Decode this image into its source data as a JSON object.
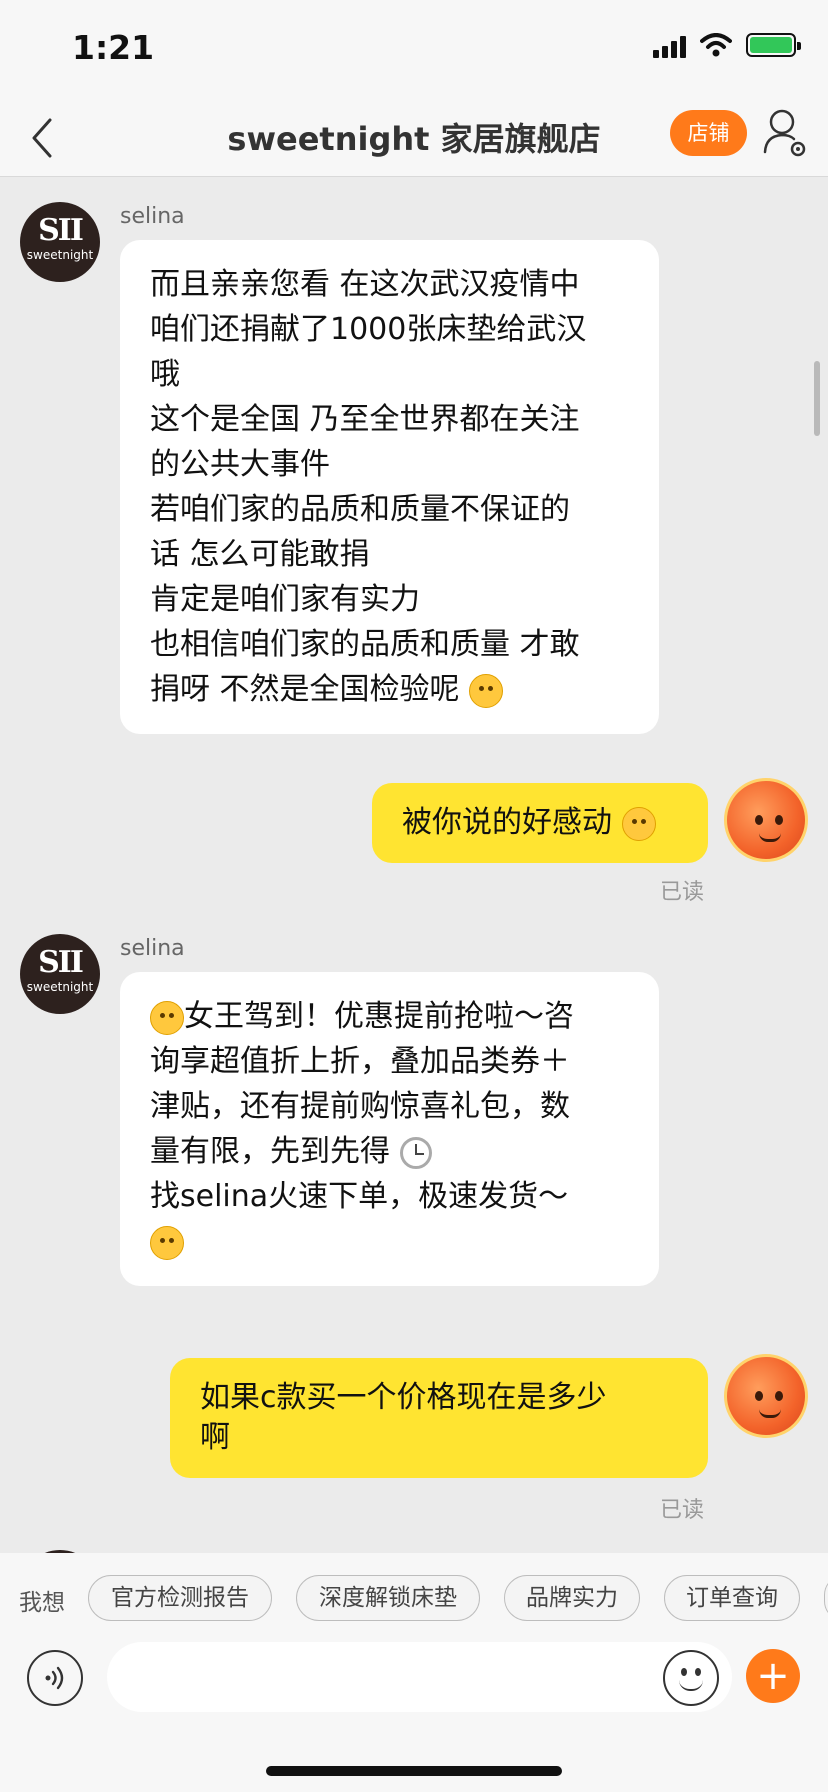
{
  "status_bar": {
    "time": "1:21"
  },
  "header": {
    "title": "sweetnight 家居旗舰店",
    "shop_button_label": "店铺"
  },
  "shop_avatar": {
    "mark": "SII",
    "text": "sweetnight"
  },
  "messages": [
    {
      "sender": "selina",
      "lines": [
        "而且亲亲您看 在这次武汉疫情中",
        "咱们还捐献了1000张床垫给武汉",
        "哦",
        "这个是全国 乃至全世界都在关注",
        "的公共大事件",
        "若咱们家的品质和质量不保证的",
        "话 怎么可能敢捐",
        "肯定是咱们家有实力",
        "也相信咱们家的品质和质量 才敢",
        "捐呀 不然是全国检验呢"
      ]
    },
    {
      "text": "被你说的好感动",
      "status": "已读"
    },
    {
      "sender": "selina",
      "lines": [
        "女王驾到！优惠提前抢啦～咨",
        "询享超值折上折，叠加品类券＋",
        "津贴，还有提前购惊喜礼包，数",
        "量有限，先到先得",
        "找selina火速下单，极速发货～"
      ]
    },
    {
      "lines": [
        "如果c款买一个价格现在是多少",
        "啊"
      ],
      "status": "已读"
    }
  ],
  "quick_replies": {
    "label": "我想",
    "items": [
      "官方检测报告",
      "深度解锁床垫",
      "品牌实力",
      "订单查询"
    ]
  },
  "input": {
    "placeholder": ""
  },
  "colors": {
    "accent": "#ff7a1a",
    "own_bubble": "#ffe431",
    "battery": "#32c759"
  }
}
